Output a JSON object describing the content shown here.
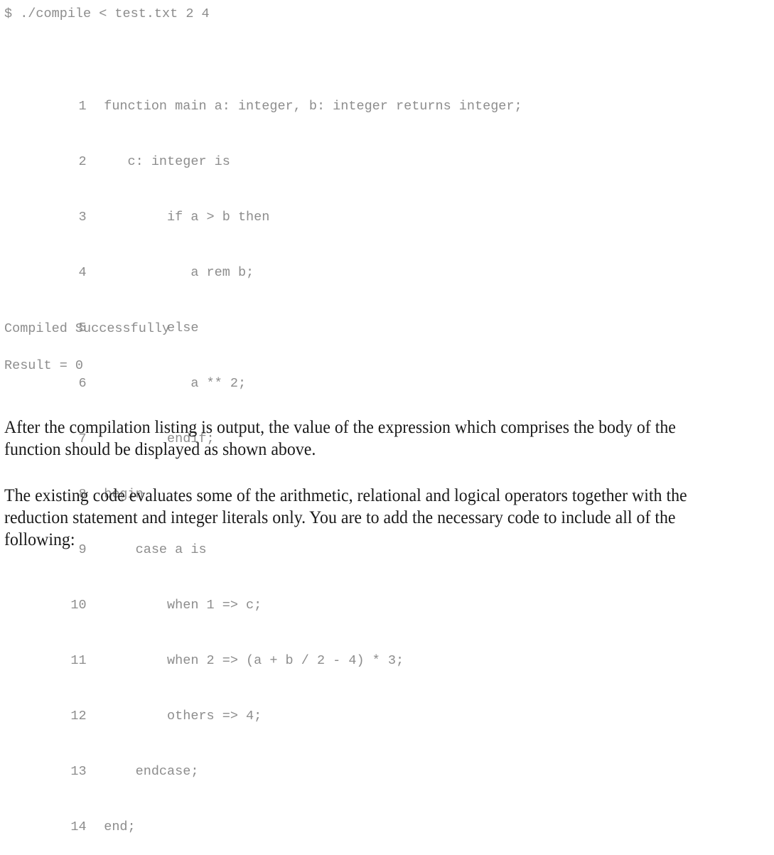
{
  "terminal": {
    "prompt_line": "$ ./compile < test.txt 2 4",
    "listing": [
      {
        "number": "1",
        "code": "function main a: integer, b: integer returns integer;"
      },
      {
        "number": "2",
        "code": "   c: integer is"
      },
      {
        "number": "3",
        "code": "        if a > b then"
      },
      {
        "number": "4",
        "code": "           a rem b;"
      },
      {
        "number": "5",
        "code": "        else"
      },
      {
        "number": "6",
        "code": "           a ** 2;"
      },
      {
        "number": "7",
        "code": "        endif;"
      },
      {
        "number": "8",
        "code": "begin"
      },
      {
        "number": "9",
        "code": "    case a is"
      },
      {
        "number": "10",
        "code": "        when 1 => c;"
      },
      {
        "number": "11",
        "code": "        when 2 => (a + b / 2 - 4) * 3;"
      },
      {
        "number": "12",
        "code": "        others => 4;"
      },
      {
        "number": "13",
        "code": "    endcase;"
      },
      {
        "number": "14",
        "code": "end;"
      }
    ],
    "compiled_message": "Compiled Successfully",
    "result_message": "Result = 0"
  },
  "prose": {
    "paragraph_1": "After the compilation listing is output, the value of the expression which comprises the body of the function should be displayed as shown above.",
    "paragraph_2": "The existing code evaluates some of the arithmetic, relational and logical operators together with the reduction statement and integer literals only. You are to add the necessary code to include all of the following:"
  },
  "colors": {
    "console_text": "#8d8d8d",
    "prose_text": "#1a1a1a",
    "background": "#ffffff"
  }
}
